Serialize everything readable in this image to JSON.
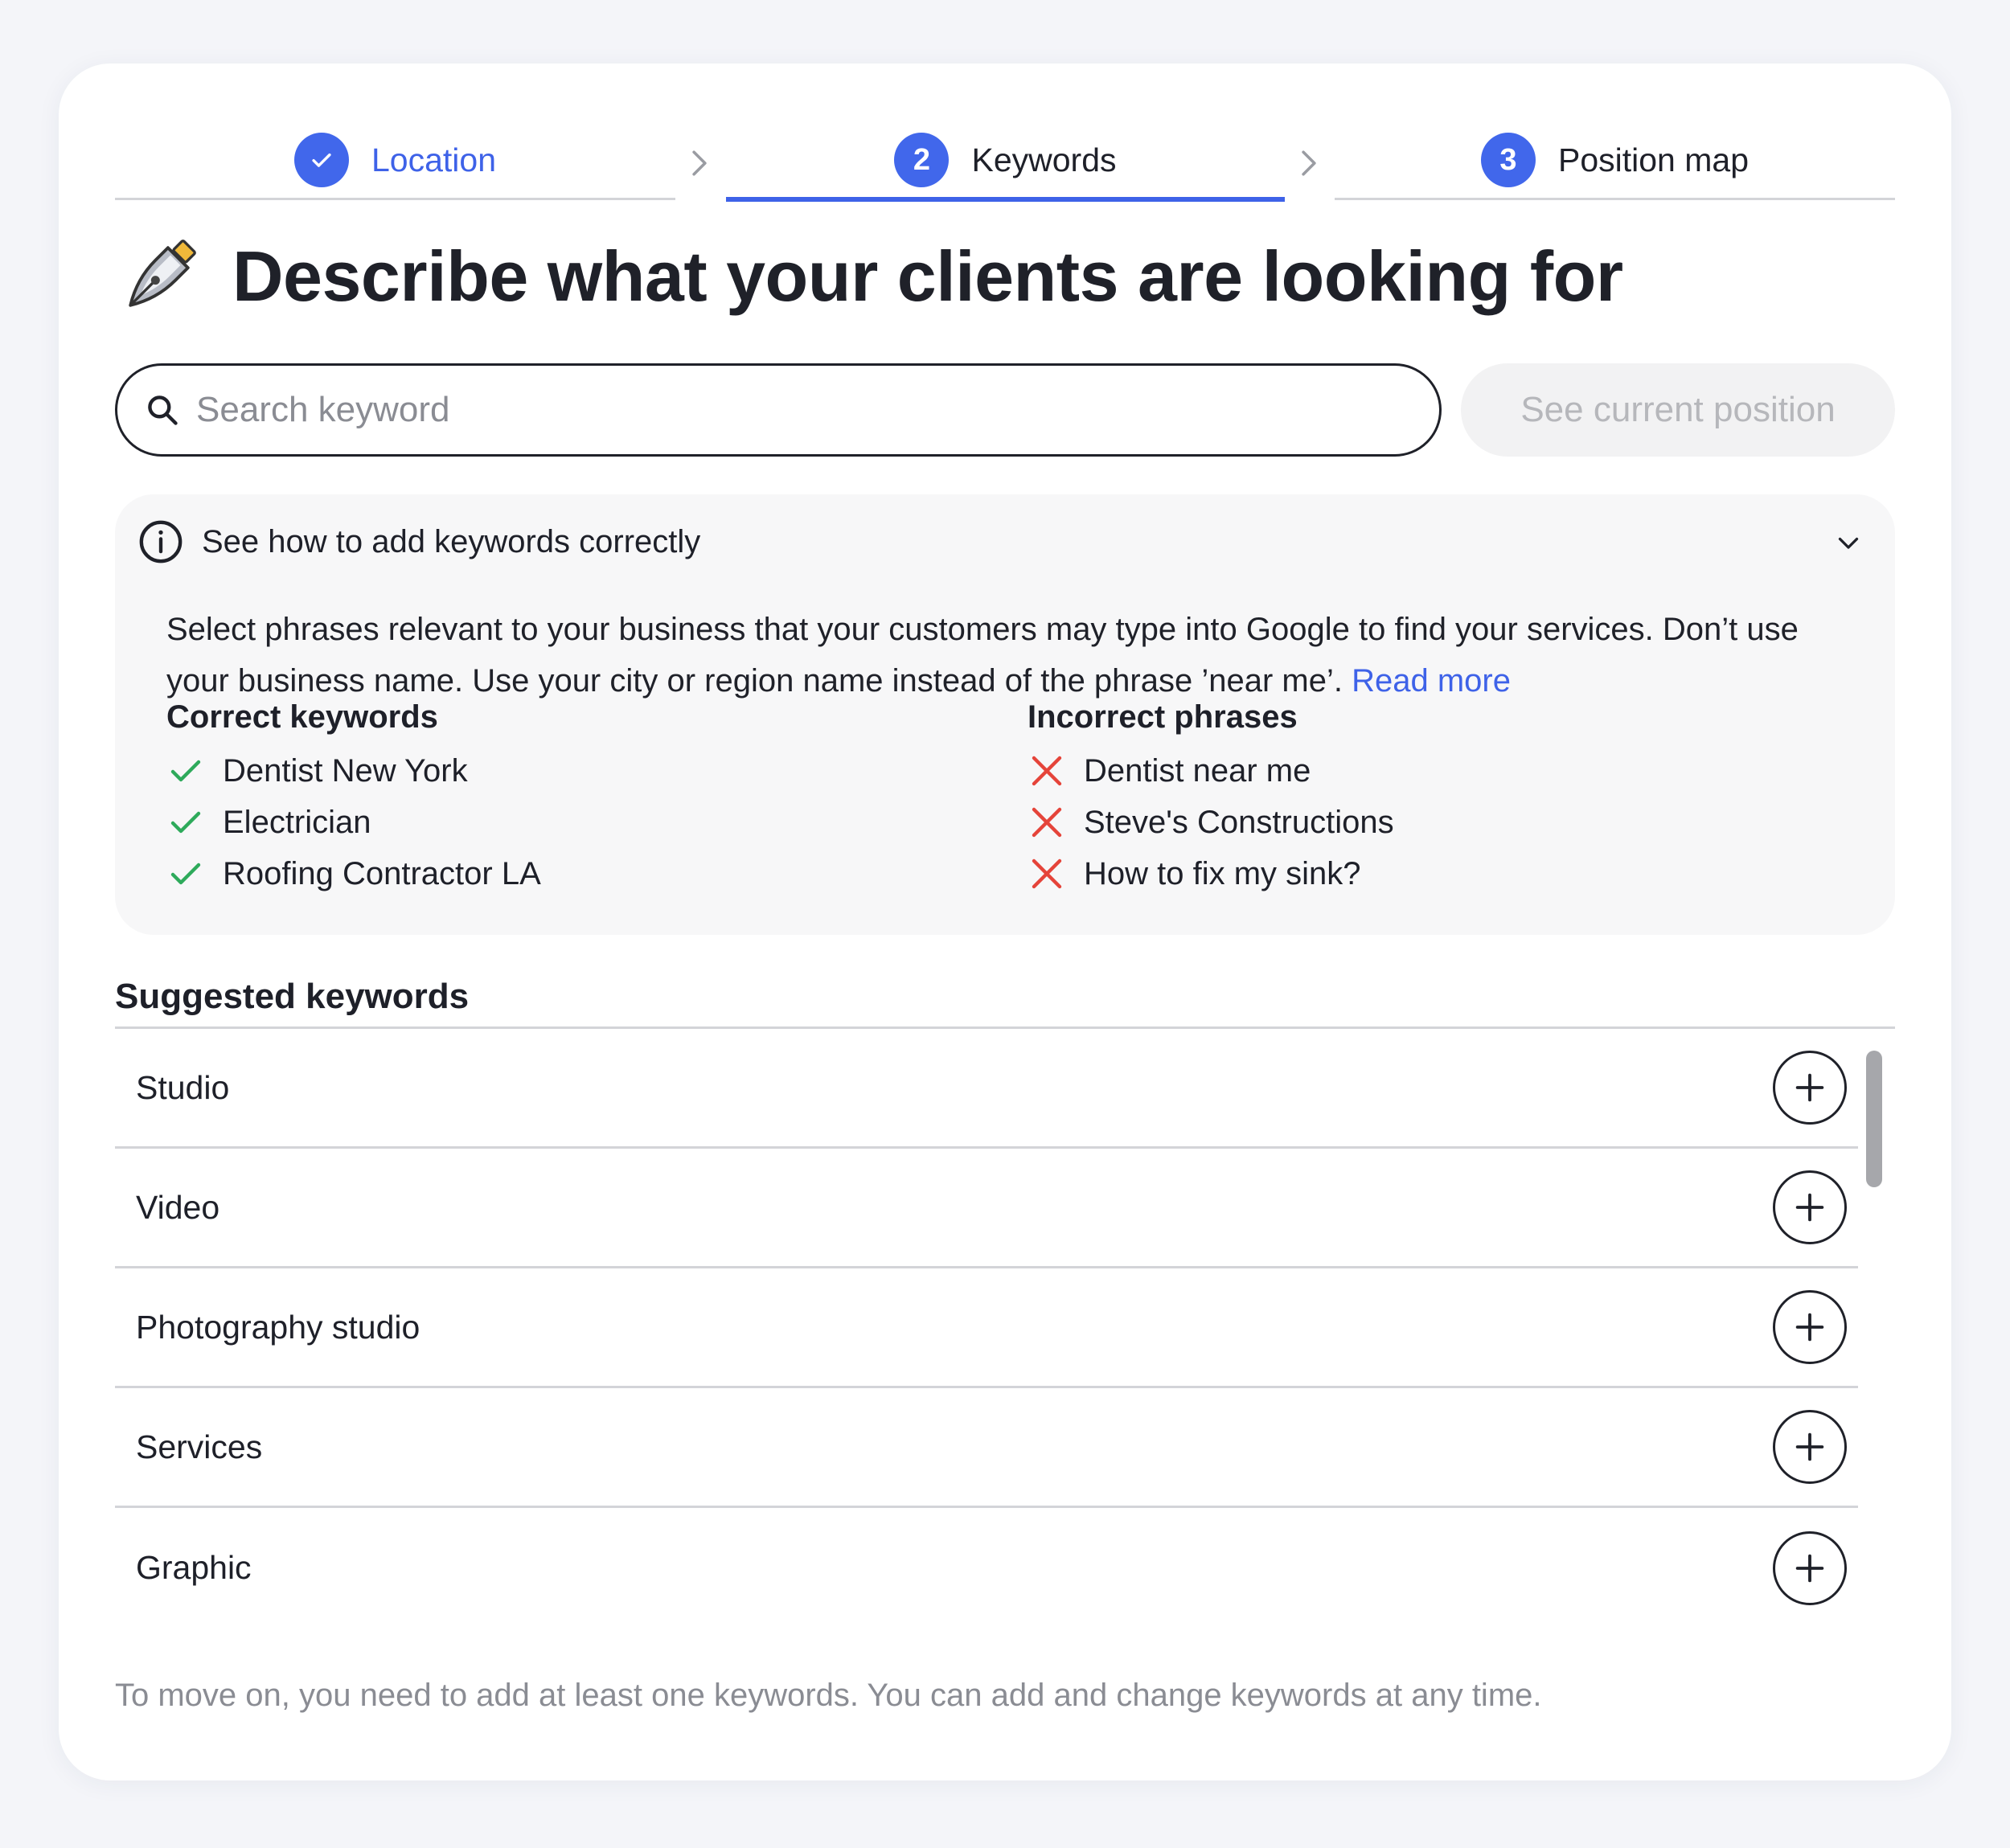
{
  "stepper": {
    "steps": [
      {
        "number": "",
        "label": "Location",
        "state": "done"
      },
      {
        "number": "2",
        "label": "Keywords",
        "state": "active"
      },
      {
        "number": "3",
        "label": "Position map",
        "state": "upcoming"
      }
    ]
  },
  "header": {
    "title": "Describe what your clients are looking for",
    "icon": "fountain-pen-icon"
  },
  "search": {
    "placeholder": "Search keyword",
    "value": ""
  },
  "see_position_button": "See current position",
  "info": {
    "heading": "See how to add keywords correctly",
    "body": "Select phrases relevant to your business that your customers may type into Google to find your services. Don’t use your business name. Use your city or region name instead of the phrase ’near me’.",
    "read_more": "Read more",
    "correct": {
      "title": "Correct keywords",
      "items": [
        "Dentist New York",
        "Electrician",
        "Roofing Contractor LA"
      ]
    },
    "incorrect": {
      "title": "Incorrect phrases",
      "items": [
        "Dentist near me",
        "Steve's Constructions",
        "How to fix my sink?"
      ]
    }
  },
  "suggested": {
    "title": "Suggested keywords",
    "items": [
      "Studio",
      "Video",
      "Photography studio",
      "Services",
      "Graphic"
    ]
  },
  "footer_note": "To move on, you need to add at least one keywords. You can add and change keywords at any time.",
  "colors": {
    "accent": "#3e62e8",
    "check_green": "#2eaa5b",
    "cross_red": "#e5443a",
    "muted": "#8a8c93"
  }
}
